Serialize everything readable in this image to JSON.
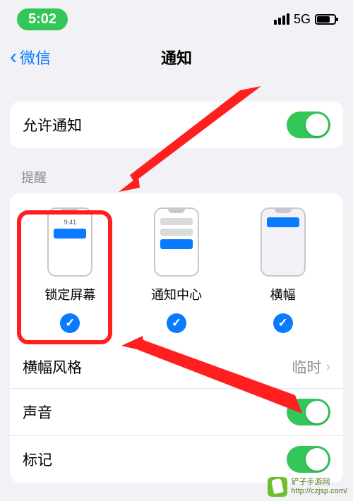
{
  "status": {
    "time": "5:02",
    "network": "5G"
  },
  "nav": {
    "back_label": "微信",
    "title": "通知"
  },
  "allow": {
    "label": "允许通知",
    "enabled": true
  },
  "alerts": {
    "section_header": "提醒",
    "lockscreen": {
      "label": "锁定屏幕",
      "preview_time": "9:41",
      "checked": true
    },
    "center": {
      "label": "通知中心",
      "checked": true
    },
    "banner": {
      "label": "横幅",
      "checked": true
    }
  },
  "settings": {
    "banner_style": {
      "label": "横幅风格",
      "value": "临时"
    },
    "sound": {
      "label": "声音",
      "enabled": true
    },
    "badge": {
      "label": "标记",
      "enabled": true
    }
  },
  "watermark": {
    "line1": "铲子手游网",
    "line2": "http://czjsp.com/"
  }
}
